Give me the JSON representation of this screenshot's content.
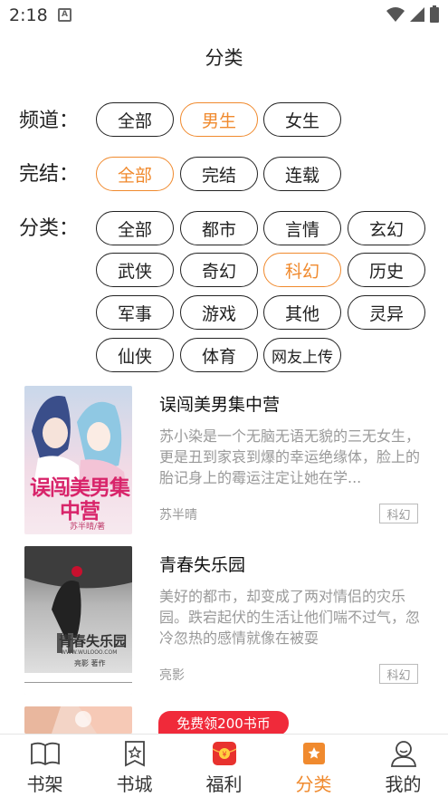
{
  "status_bar": {
    "time": "2:18",
    "notification_icon": "A"
  },
  "page_title": "分类",
  "filters": {
    "channel": {
      "label": "频道：",
      "options": [
        "全部",
        "男生",
        "女生"
      ],
      "selected": "男生"
    },
    "status": {
      "label": "完结：",
      "options": [
        "全部",
        "完结",
        "连载"
      ],
      "selected": "全部"
    },
    "category": {
      "label": "分类：",
      "options": [
        "全部",
        "都市",
        "言情",
        "玄幻",
        "武侠",
        "奇幻",
        "科幻",
        "历史",
        "军事",
        "游戏",
        "其他",
        "灵异",
        "仙侠",
        "体育",
        "网友上传"
      ],
      "selected": "科幻"
    }
  },
  "books": [
    {
      "title": "误闯美男集中营",
      "description": "苏小染是一个无脑无语无貌的三无女生，更是丑到家哀到爆的幸运绝缘体，脸上的胎记身上的霉运注定让她在学...",
      "author": "苏半晴",
      "tag": "科幻",
      "cover_text": "误闯美男集中营",
      "cover_subtext": "苏半晴/著"
    },
    {
      "title": "青春失乐园",
      "description": "美好的都市，却变成了两对情侣的灾乐园。跌宕起伏的生活让他们喘不过气，忽冷忽热的感情就像在被耍",
      "author": "亮影",
      "tag": "科幻",
      "cover_text": "青春失乐园",
      "cover_subtext": "亮影 著作",
      "cover_url_text": "WWW.WULOOO.COM"
    }
  ],
  "promo_badge": "免费领200书币",
  "bottom_nav": [
    {
      "label": "书架",
      "icon": "book-open-icon",
      "active": false
    },
    {
      "label": "书城",
      "icon": "bookstore-icon",
      "active": false
    },
    {
      "label": "福利",
      "icon": "red-envelope-icon",
      "active": false
    },
    {
      "label": "分类",
      "icon": "category-bookmark-icon",
      "active": true
    },
    {
      "label": "我的",
      "icon": "user-icon",
      "active": false
    }
  ],
  "colors": {
    "accent": "#f08a2e",
    "promo": "#f02a3a",
    "nav_red": "#e8322e"
  }
}
